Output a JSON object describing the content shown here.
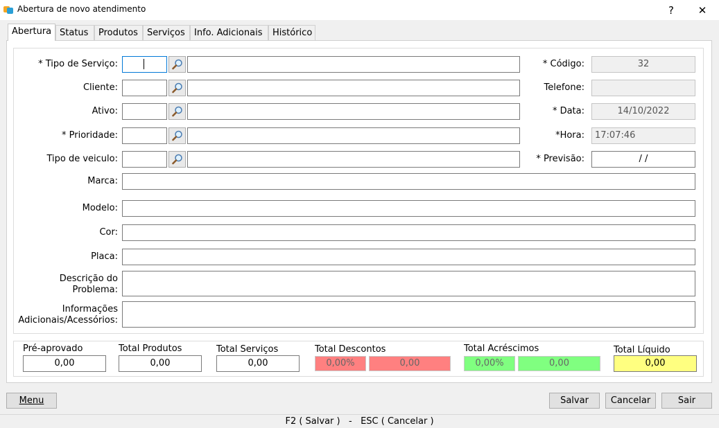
{
  "window": {
    "title": "Abertura de novo atendimento",
    "help": "?",
    "close": "✕"
  },
  "tabs": [
    "Abertura",
    "Status",
    "Produtos",
    "Serviços",
    "Info. Adicionais",
    "Histórico"
  ],
  "form": {
    "tipo_servico_label": "* Tipo de Serviço:",
    "cliente_label": "Cliente:",
    "ativo_label": "Ativo:",
    "prioridade_label": "* Prioridade:",
    "tipo_veiculo_label": "Tipo de veiculo:",
    "marca_label": "Marca:",
    "modelo_label": "Modelo:",
    "cor_label": "Cor:",
    "placa_label": "Placa:",
    "descricao_label_1": "Descrição do",
    "descricao_label_2": "Problema:",
    "info_label_1": "Informações",
    "info_label_2": "Adicionais/Acessórios:",
    "codigo_label": "* Código:",
    "codigo_value": "32",
    "telefone_label": "Telefone:",
    "data_label": "* Data:",
    "data_value": "14/10/2022",
    "hora_label": "*Hora:",
    "hora_value": "17:07:46",
    "previsao_label": "* Previsão:",
    "previsao_value": "/ /"
  },
  "totals": {
    "pre_aprovado_label": "Pré-aprovado",
    "pre_aprovado_value": "0,00",
    "produtos_label": "Total Produtos",
    "produtos_value": "0,00",
    "servicos_label": "Total Serviços",
    "servicos_value": "0,00",
    "descontos_label": "Total Descontos",
    "descontos_pct": "0,00%",
    "descontos_value": "0,00",
    "acrescimos_label": "Total Acréscimos",
    "acrescimos_pct": "0,00%",
    "acrescimos_value": "0,00",
    "liquido_label": "Total Líquido",
    "liquido_value": "0,00"
  },
  "buttons": {
    "menu": "Menu",
    "salvar": "Salvar",
    "cancelar": "Cancelar",
    "sair": "Sair"
  },
  "statusbar": "F2 ( Salvar )   -   ESC ( Cancelar )",
  "colors": {
    "desconto": "#ff8080",
    "acrescimo": "#80ff80",
    "liquido": "#ffff80",
    "focus": "#0078d7"
  },
  "icons": {
    "lookup": "magnifier-icon",
    "app": "app-icon"
  }
}
